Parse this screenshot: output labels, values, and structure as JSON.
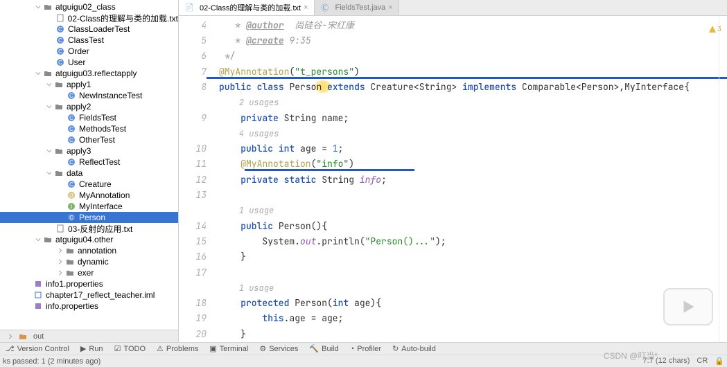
{
  "tabs": [
    {
      "label": "02-Class的理解与类的加载.txt",
      "active": true
    },
    {
      "label": "FieldsTest.java",
      "active": false
    }
  ],
  "tree": {
    "n0": "atguigu02_class",
    "n1": "02-Class的理解与类的加载.txt",
    "n2": "ClassLoaderTest",
    "n3": "ClassTest",
    "n4": "Order",
    "n5": "User",
    "n6": "atguigu03.reflectapply",
    "n7": "apply1",
    "n8": "NewInstanceTest",
    "n9": "apply2",
    "n10": "FieldsTest",
    "n11": "MethodsTest",
    "n12": "OtherTest",
    "n13": "apply3",
    "n14": "ReflectTest",
    "n15": "data",
    "n16": "Creature",
    "n17": "MyAnnotation",
    "n18": "MyInterface",
    "n19": "Person",
    "n20": "03-反射的应用.txt",
    "n21": "atguigu04.other",
    "n22": "annotation",
    "n23": "dynamic",
    "n24": "exer",
    "n25": "info1.properties",
    "n26": "chapter17_reflect_teacher.iml",
    "n27": "info.properties",
    "n28": "out"
  },
  "gutter_lines": [
    "4",
    "5",
    "6",
    "7",
    "8",
    "",
    "9",
    "",
    "10",
    "11",
    "12",
    "13",
    "",
    "14",
    "15",
    "16",
    "17",
    "",
    "18",
    "19",
    "20"
  ],
  "code": {
    "author_tag": "@author",
    "author_val": "尚硅谷-宋红康",
    "create_tag": "@create",
    "create_val": "9:35",
    "comment_close": " */",
    "anno1": "@MyAnnotation",
    "anno1_arg": "\"t_persons\"",
    "kw_public": "public",
    "kw_class": "class",
    "cls_person": "Person",
    "kw_extends": "extends",
    "cls_creature": "Creature<String>",
    "kw_implements": "implements",
    "cls_comparable": "Comparable<Person>",
    "cls_myif": "MyInterface",
    "u1": "2 usages",
    "kw_private": "private",
    "type_string": "String",
    "fld_name": "name",
    "u2": "4 usages",
    "type_int": "int",
    "fld_age": "age",
    "eq": " = ",
    "num_1": "1",
    "anno2": "@MyAnnotation",
    "anno2_arg": "\"info\"",
    "kw_static": "static",
    "fld_info": "info",
    "u3": "1 usage",
    "ctor1": "Person(){",
    "sys": "System.",
    "out": "out",
    "println": ".println(",
    "msg": "\"Person()...\"",
    "close": ");",
    "rbrace": "}",
    "u4": "1 usage",
    "kw_protected": "protected",
    "ctor2": "Person(",
    "param": "int age){",
    "this": "this",
    "dot_age": ".age = age;"
  },
  "warn_count": "3",
  "toolbar": {
    "vc": "Version Control",
    "run": "Run",
    "todo": "TODO",
    "problems": "Problems",
    "terminal": "Terminal",
    "services": "Services",
    "build": "Build",
    "profiler": "Profiler",
    "auto": "Auto-build"
  },
  "status": {
    "left": "ks passed: 1 (2 minutes ago)",
    "pos": "7:7 (12 chars)",
    "enc": "CR",
    "sp": ""
  },
  "out_label": "out",
  "watermark": "CSDN @叮当*"
}
